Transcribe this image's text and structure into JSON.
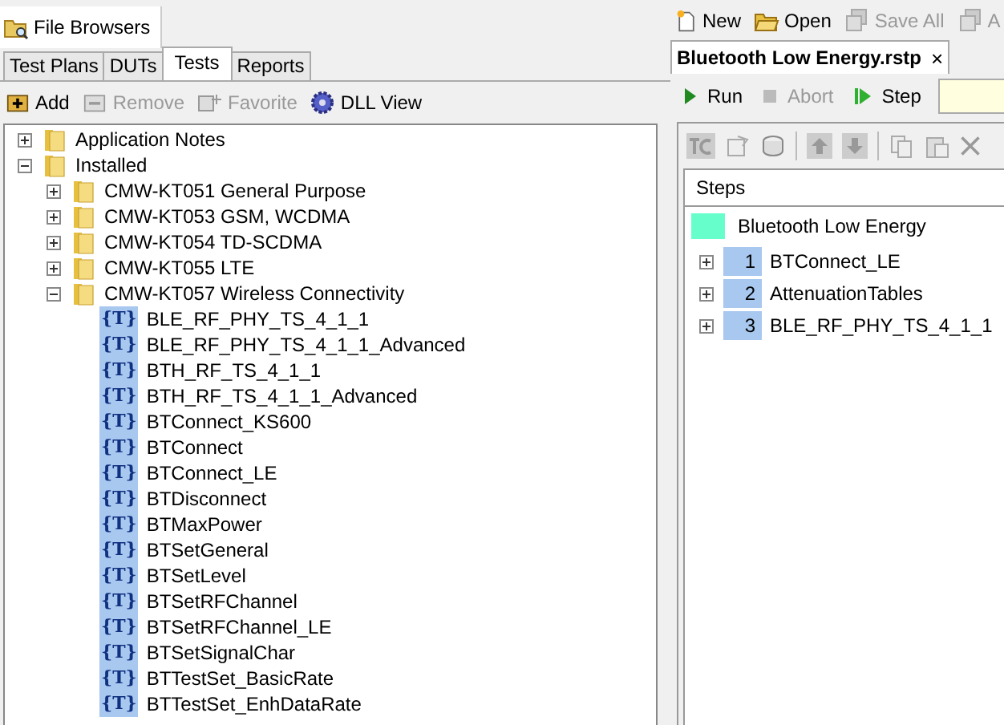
{
  "left_panel": {
    "header_tab": "File Browsers",
    "tabs": [
      {
        "label": "Test Plans",
        "selected": false
      },
      {
        "label": "DUTs",
        "selected": false
      },
      {
        "label": "Tests",
        "selected": true
      },
      {
        "label": "Reports",
        "selected": false
      }
    ],
    "toolbar": [
      {
        "label": "Add",
        "kind": "add",
        "disabled": false
      },
      {
        "label": "Remove",
        "kind": "remove",
        "disabled": true
      },
      {
        "label": "Favorite",
        "kind": "favorite",
        "disabled": true
      },
      {
        "label": "DLL View",
        "kind": "dll",
        "disabled": false
      }
    ],
    "tree": [
      {
        "label": "Application Notes",
        "kind": "folder",
        "expanded": false
      },
      {
        "label": "Installed",
        "kind": "folder",
        "expanded": true,
        "children": [
          {
            "label": "CMW-KT051 General Purpose",
            "kind": "folder",
            "expanded": false
          },
          {
            "label": "CMW-KT053 GSM, WCDMA",
            "kind": "folder",
            "expanded": false
          },
          {
            "label": "CMW-KT054 TD-SCDMA",
            "kind": "folder",
            "expanded": false
          },
          {
            "label": "CMW-KT055 LTE",
            "kind": "folder",
            "expanded": false
          },
          {
            "label": "CMW-KT057 Wireless Connectivity",
            "kind": "folder",
            "expanded": true,
            "children": [
              {
                "label": "BLE_RF_PHY_TS_4_1_1",
                "kind": "test",
                "icon": "{T}"
              },
              {
                "label": "BLE_RF_PHY_TS_4_1_1_Advanced",
                "kind": "test",
                "icon": "{T}"
              },
              {
                "label": "BTH_RF_TS_4_1_1",
                "kind": "test",
                "icon": "{T}"
              },
              {
                "label": "BTH_RF_TS_4_1_1_Advanced",
                "kind": "test",
                "icon": "{T}"
              },
              {
                "label": "BTConnect_KS600",
                "kind": "test",
                "icon": "{T}"
              },
              {
                "label": "BTConnect",
                "kind": "test",
                "icon": "{T}"
              },
              {
                "label": "BTConnect_LE",
                "kind": "test",
                "icon": "{T}"
              },
              {
                "label": "BTDisconnect",
                "kind": "test",
                "icon": "{T}"
              },
              {
                "label": "BTMaxPower",
                "kind": "test",
                "icon": "{T}"
              },
              {
                "label": "BTSetGeneral",
                "kind": "test",
                "icon": "{T}"
              },
              {
                "label": "BTSetLevel",
                "kind": "test",
                "icon": "{T}"
              },
              {
                "label": "BTSetRFChannel",
                "kind": "test",
                "icon": "{T}"
              },
              {
                "label": "BTSetRFChannel_LE",
                "kind": "test",
                "icon": "{T}"
              },
              {
                "label": "BTSetSignalChar",
                "kind": "test",
                "icon": "{T}"
              },
              {
                "label": "BTTestSet_BasicRate",
                "kind": "test",
                "icon": "{T}"
              },
              {
                "label": "BTTestSet_EnhDataRate",
                "kind": "test",
                "icon": "{T}"
              }
            ]
          }
        ]
      }
    ]
  },
  "right_panel": {
    "toolbar": [
      {
        "label": "New",
        "kind": "new",
        "disabled": false
      },
      {
        "label": "Open",
        "kind": "open",
        "disabled": false
      },
      {
        "label": "Save All",
        "kind": "save",
        "disabled": true
      },
      {
        "label": "A",
        "kind": "save",
        "disabled": true
      }
    ],
    "document_tab": {
      "title": "Bluetooth Low Energy.rstp",
      "close": "×"
    },
    "run_bar": [
      {
        "label": "Run",
        "kind": "run",
        "disabled": false
      },
      {
        "label": "Abort",
        "kind": "abort",
        "disabled": true
      },
      {
        "label": "Step",
        "kind": "step",
        "disabled": false
      }
    ],
    "steps_header": "Steps",
    "plan": {
      "label": "Bluetooth Low Energy",
      "color": "#66ffcc",
      "steps": [
        {
          "number": "1",
          "label": "BTConnect_LE",
          "expanded": false
        },
        {
          "number": "2",
          "label": "AttenuationTables",
          "expanded": false
        },
        {
          "number": "3",
          "label": "BLE_RF_PHY_TS_4_1_1",
          "expanded": false
        }
      ]
    }
  }
}
